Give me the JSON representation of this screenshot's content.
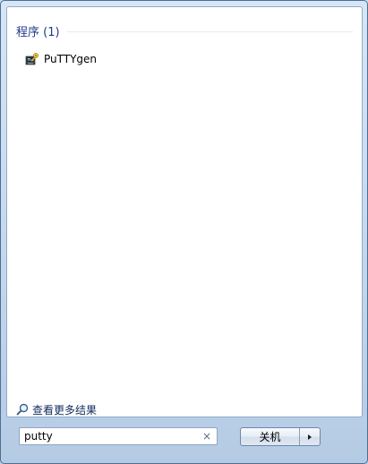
{
  "results": {
    "group_title": "程序 (1)",
    "items": [
      {
        "label": "PuTTYgen",
        "icon": "puttygen-icon"
      }
    ]
  },
  "more_results": {
    "label": "查看更多结果",
    "icon": "search-icon"
  },
  "search": {
    "value": "putty",
    "clear_icon": "×"
  },
  "shutdown": {
    "label": "关机",
    "arrow_icon": "triangle-right-icon"
  }
}
